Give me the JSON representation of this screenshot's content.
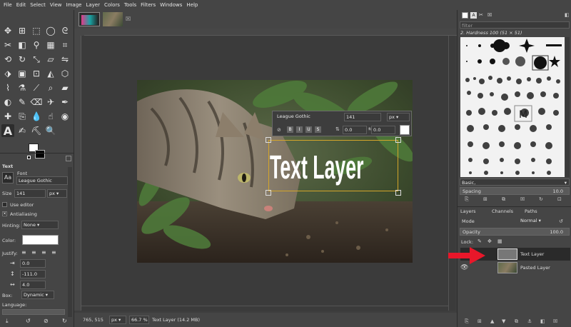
{
  "menubar": {
    "items": [
      "File",
      "Edit",
      "Select",
      "View",
      "Image",
      "Layer",
      "Colors",
      "Tools",
      "Filters",
      "Windows",
      "Help"
    ]
  },
  "tool_options": {
    "title": "Text",
    "font_label": "Font",
    "font_value": "League Gothic",
    "size_label": "Size",
    "size_value": "141",
    "size_unit": "px",
    "use_editor_label": "Use editor",
    "antialiasing_label": "Antialiasing",
    "hinting_label": "Hinting:",
    "hinting_value": "None",
    "color_label": "Color:",
    "justify_label": "Justify:",
    "indent_value": "0.0",
    "line_spacing_value": "-111.0",
    "letter_spacing_value": "4.0",
    "box_label": "Box:",
    "box_value": "Dynamic",
    "language_label": "Language:"
  },
  "text_toolbar": {
    "font": "League Gothic",
    "size": "141",
    "unit": "px",
    "baseline": "0.0",
    "kerning": "0.0"
  },
  "canvas": {
    "text_layer_text": "Text Layer"
  },
  "statusbar": {
    "coords": "765, 515",
    "unit": "px",
    "zoom": "66.7 %",
    "info": "Text Layer (14.2 MB)"
  },
  "brushes": {
    "filter_placeholder": "filter",
    "selected": "2. Hardness 100 (51 × 51)",
    "preset": "Basic,",
    "spacing_label": "Spacing",
    "spacing_value": "10.0"
  },
  "layers": {
    "tabs": [
      "Layers",
      "Channels",
      "Paths"
    ],
    "mode_label": "Mode",
    "mode_value": "Normal",
    "opacity_label": "Opacity",
    "opacity_value": "100.0",
    "lock_label": "Lock:",
    "items": [
      {
        "name": "Text Layer"
      },
      {
        "name": "Pasted Layer"
      }
    ]
  },
  "colors": {
    "accent_red": "#e8172a",
    "text_box_outline": "#d4a52a"
  }
}
